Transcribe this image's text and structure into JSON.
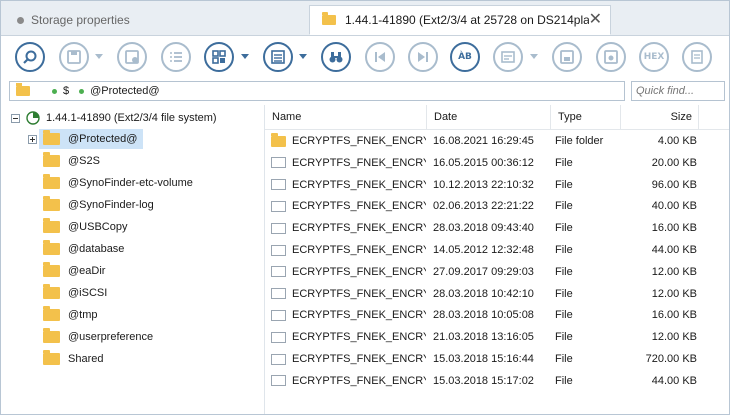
{
  "tabs": [
    {
      "label": "Storage properties",
      "active": false
    },
    {
      "label": "1.44.1-41890 (Ext2/3/4 at 25728 on DS214pla",
      "active": true
    }
  ],
  "toolbar": {
    "buttons": [
      {
        "name": "search-icon",
        "disabled": false
      },
      {
        "name": "save-icon",
        "disabled": true
      },
      {
        "name": "save-info-icon",
        "disabled": true
      },
      {
        "name": "checklist-icon",
        "disabled": true
      },
      {
        "name": "grid-view-icon",
        "disabled": false
      },
      {
        "name": "list-view-icon",
        "disabled": false
      },
      {
        "name": "binoculars-icon",
        "disabled": false
      },
      {
        "name": "prev-icon",
        "disabled": true
      },
      {
        "name": "next-icon",
        "disabled": true
      },
      {
        "name": "case-icon",
        "disabled": false
      },
      {
        "name": "text-icon",
        "disabled": true
      },
      {
        "name": "save-region-icon",
        "disabled": true
      },
      {
        "name": "save-disk-icon",
        "disabled": true
      },
      {
        "name": "hex-icon",
        "disabled": true
      },
      {
        "name": "document-icon",
        "disabled": true
      }
    ],
    "hex_label": "HEX",
    "case_label": "ÀB"
  },
  "address": {
    "seg1": "$",
    "seg2": "@Protected@"
  },
  "find": {
    "placeholder": "Quick find..."
  },
  "tree": {
    "root": "1.44.1-41890 (Ext2/3/4 file system)",
    "items": [
      {
        "label": "@Protected@",
        "selected": true
      },
      {
        "label": "@S2S"
      },
      {
        "label": "@SynoFinder-etc-volume"
      },
      {
        "label": "@SynoFinder-log"
      },
      {
        "label": "@USBCopy"
      },
      {
        "label": "@database"
      },
      {
        "label": "@eaDir"
      },
      {
        "label": "@iSCSI"
      },
      {
        "label": "@tmp"
      },
      {
        "label": "@userpreference"
      },
      {
        "label": "Shared"
      }
    ]
  },
  "columns": {
    "name": "Name",
    "date": "Date",
    "type": "Type",
    "size": "Size"
  },
  "files": [
    {
      "name": "ECRYPTFS_FNEK_ENCRY...",
      "date": "16.08.2021 16:29:45",
      "type": "File folder",
      "size": "4.00 KB",
      "folder": true
    },
    {
      "name": "ECRYPTFS_FNEK_ENCRY...",
      "date": "16.05.2015 00:36:12",
      "type": "File",
      "size": "20.00 KB"
    },
    {
      "name": "ECRYPTFS_FNEK_ENCRY...",
      "date": "10.12.2013 22:10:32",
      "type": "File",
      "size": "96.00 KB"
    },
    {
      "name": "ECRYPTFS_FNEK_ENCRY...",
      "date": "02.06.2013 22:21:22",
      "type": "File",
      "size": "40.00 KB"
    },
    {
      "name": "ECRYPTFS_FNEK_ENCRY...",
      "date": "28.03.2018 09:43:40",
      "type": "File",
      "size": "16.00 KB"
    },
    {
      "name": "ECRYPTFS_FNEK_ENCRY...",
      "date": "14.05.2012 12:32:48",
      "type": "File",
      "size": "44.00 KB"
    },
    {
      "name": "ECRYPTFS_FNEK_ENCRY...",
      "date": "27.09.2017 09:29:03",
      "type": "File",
      "size": "12.00 KB"
    },
    {
      "name": "ECRYPTFS_FNEK_ENCRY...",
      "date": "28.03.2018 10:42:10",
      "type": "File",
      "size": "12.00 KB"
    },
    {
      "name": "ECRYPTFS_FNEK_ENCRY...",
      "date": "28.03.2018 10:05:08",
      "type": "File",
      "size": "16.00 KB"
    },
    {
      "name": "ECRYPTFS_FNEK_ENCRY...",
      "date": "21.03.2018 13:16:05",
      "type": "File",
      "size": "12.00 KB"
    },
    {
      "name": "ECRYPTFS_FNEK_ENCRY...",
      "date": "15.03.2018 15:16:44",
      "type": "File",
      "size": "720.00 KB"
    },
    {
      "name": "ECRYPTFS_FNEK_ENCRY...",
      "date": "15.03.2018 15:17:02",
      "type": "File",
      "size": "44.00 KB"
    }
  ]
}
